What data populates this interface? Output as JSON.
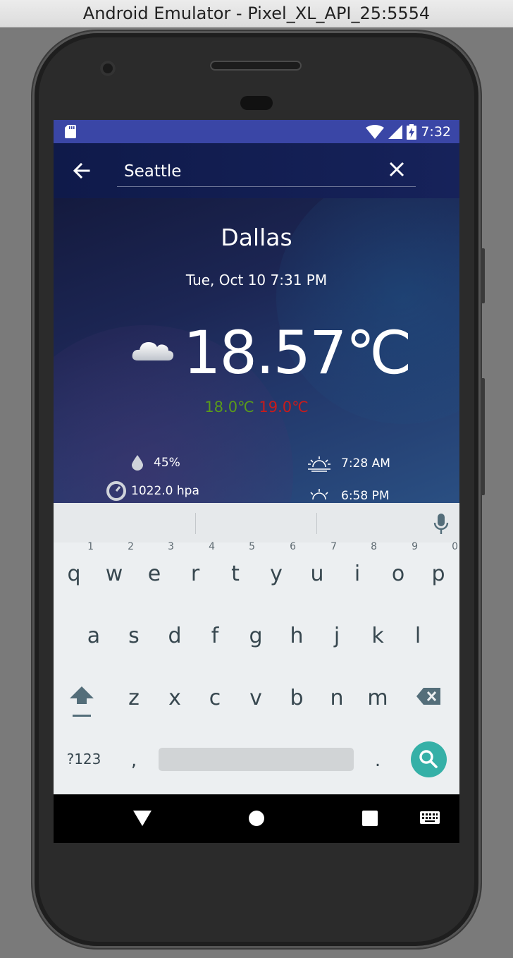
{
  "window": {
    "title": "Android Emulator - Pixel_XL_API_25:5554"
  },
  "status_bar": {
    "time": "7:32"
  },
  "search": {
    "value": "Seattle"
  },
  "weather": {
    "city": "Dallas",
    "datetime": "Tue, Oct 10 7:31 PM",
    "temperature": "18.57℃",
    "temp_min": "18.0℃",
    "temp_max": "19.0℃",
    "humidity": "45%",
    "sunrise": "7:28 AM",
    "pressure": "1022.0 hpa",
    "sunset": "6:58 PM"
  },
  "keyboard": {
    "row1": [
      {
        "key": "q",
        "hint": "1"
      },
      {
        "key": "w",
        "hint": "2"
      },
      {
        "key": "e",
        "hint": "3"
      },
      {
        "key": "r",
        "hint": "4"
      },
      {
        "key": "t",
        "hint": "5"
      },
      {
        "key": "y",
        "hint": "6"
      },
      {
        "key": "u",
        "hint": "7"
      },
      {
        "key": "i",
        "hint": "8"
      },
      {
        "key": "o",
        "hint": "9"
      },
      {
        "key": "p",
        "hint": "0"
      }
    ],
    "row2": [
      "a",
      "s",
      "d",
      "f",
      "g",
      "h",
      "j",
      "k",
      "l"
    ],
    "row3": [
      "z",
      "x",
      "c",
      "v",
      "b",
      "n",
      "m"
    ],
    "symbols_label": "?123",
    "comma": ",",
    "period": "."
  },
  "colors": {
    "status_bar": "#3a46a6",
    "app_bar": "#16225a",
    "temp_min": "#5a9b1a",
    "temp_max": "#c81b1b",
    "search_key": "#35b0a7"
  }
}
